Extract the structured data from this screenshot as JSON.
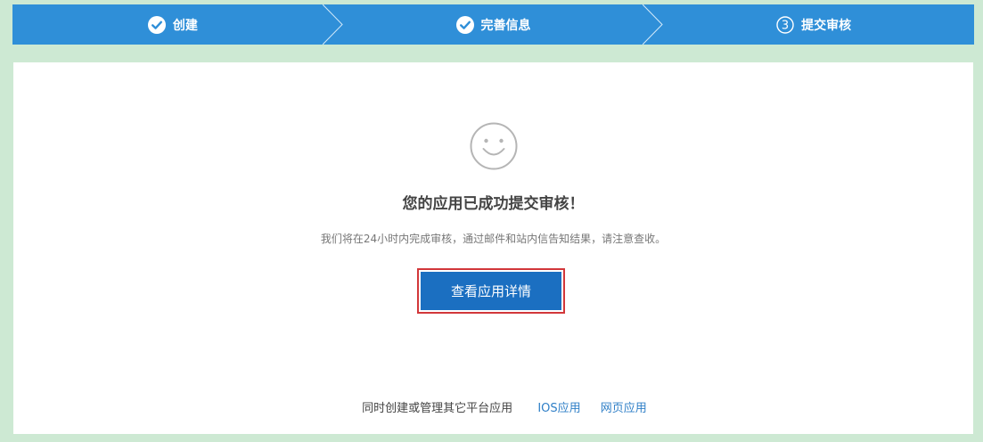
{
  "steps": [
    {
      "label": "创建",
      "state": "done"
    },
    {
      "label": "完善信息",
      "state": "done"
    },
    {
      "label": "提交审核",
      "state": "current",
      "number": "3"
    }
  ],
  "result": {
    "title": "您的应用已成功提交审核！",
    "description": "我们将在24小时内完成审核，通过邮件和站内信告知结果，请注意查收。",
    "button_label": "查看应用详情"
  },
  "footer": {
    "text": "同时创建或管理其它平台应用",
    "links": [
      "IOS应用",
      "网页应用"
    ]
  },
  "colors": {
    "stepbar": "#2f8fd8",
    "button": "#1b6fc1",
    "highlight_border": "#d2373a",
    "link": "#2f7fc7",
    "page_bg": "#cde9d3"
  },
  "icons": {
    "done_step": "check-circle-icon",
    "current_step": "number-circle-icon",
    "result": "smiley-face-icon"
  }
}
